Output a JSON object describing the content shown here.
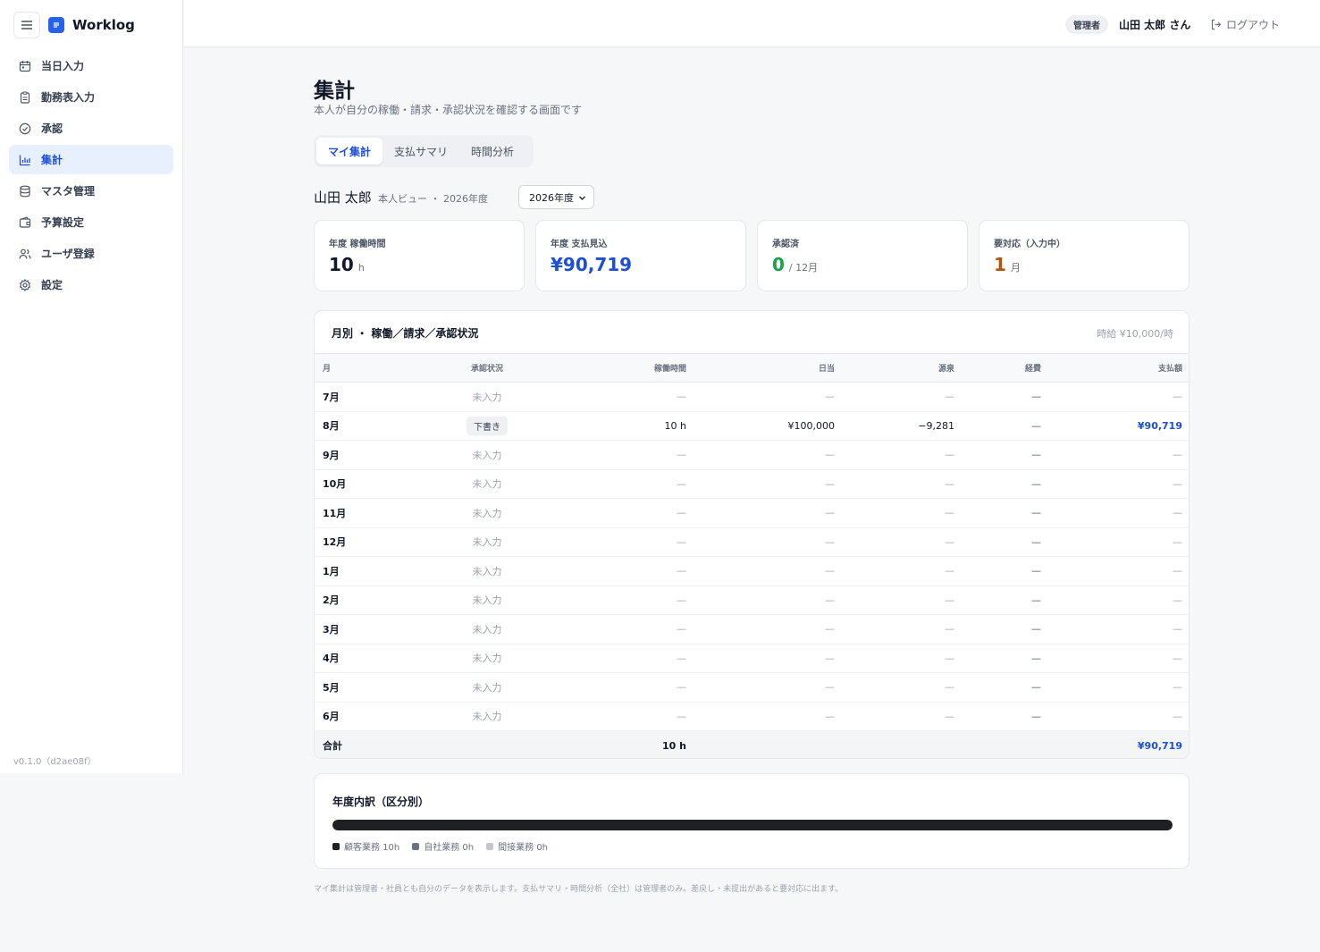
{
  "app": {
    "name": "Worklog",
    "version": "v0.1.0（d2ae08f）",
    "accent": "#2563eb"
  },
  "sidebar": {
    "items": [
      {
        "label": "当日入力",
        "icon": "calendar-icon"
      },
      {
        "label": "勤務表入力",
        "icon": "clipboard-icon"
      },
      {
        "label": "承認",
        "icon": "check-circle-icon"
      },
      {
        "label": "集計",
        "icon": "bar-chart-icon",
        "active": true
      },
      {
        "label": "マスタ管理",
        "icon": "database-icon"
      },
      {
        "label": "予算設定",
        "icon": "wallet-icon"
      },
      {
        "label": "ユーザ登録",
        "icon": "users-icon"
      },
      {
        "label": "設定",
        "icon": "gear-icon"
      }
    ]
  },
  "header": {
    "role": "管理者",
    "user": "山田 太郎 さん",
    "logout": "ログアウト"
  },
  "page": {
    "title": "集計",
    "subtitle": "本人が自分の稼働・請求・承認状況を確認する画面です",
    "tabs": [
      {
        "label": "マイ集計",
        "active": true
      },
      {
        "label": "支払サマリ"
      },
      {
        "label": "時間分析"
      }
    ],
    "person": "山田 太郎",
    "view": "本人ビュー ・ 2026年度",
    "year_select": "2026年度"
  },
  "cards": [
    {
      "label": "年度 稼働時間",
      "value": "10",
      "unit": "h",
      "color": "#111827"
    },
    {
      "label": "年度 支払見込",
      "value": "¥90,719",
      "unit": "",
      "color": "#1d4ed8"
    },
    {
      "label": "承認済",
      "value": "0",
      "unit": "/ 12月",
      "color": "#16a34a"
    },
    {
      "label": "要対応（入力中）",
      "value": "1",
      "unit": "月",
      "color": "#b45309"
    }
  ],
  "monthly": {
    "title": "月別 ・ 稼働／請求／承認状況",
    "rate": "時給 ¥10,000/時",
    "headers": [
      "月",
      "承認状況",
      "稼働時間",
      "日当",
      "源泉",
      "経費",
      "支払額"
    ],
    "rows": [
      {
        "month": "7月",
        "status": "未入力",
        "hours": "—",
        "daily": "—",
        "tax": "—",
        "expense": "—",
        "pay": "—"
      },
      {
        "month": "8月",
        "status": "下書き",
        "draft": true,
        "hours": "10 h",
        "daily": "¥100,000",
        "tax": "−9,281",
        "expense": "—",
        "pay": "¥90,719"
      },
      {
        "month": "9月",
        "status": "未入力",
        "hours": "—",
        "daily": "—",
        "tax": "—",
        "expense": "—",
        "pay": "—"
      },
      {
        "month": "10月",
        "status": "未入力",
        "hours": "—",
        "daily": "—",
        "tax": "—",
        "expense": "—",
        "pay": "—"
      },
      {
        "month": "11月",
        "status": "未入力",
        "hours": "—",
        "daily": "—",
        "tax": "—",
        "expense": "—",
        "pay": "—"
      },
      {
        "month": "12月",
        "status": "未入力",
        "hours": "—",
        "daily": "—",
        "tax": "—",
        "expense": "—",
        "pay": "—"
      },
      {
        "month": "1月",
        "status": "未入力",
        "hours": "—",
        "daily": "—",
        "tax": "—",
        "expense": "—",
        "pay": "—"
      },
      {
        "month": "2月",
        "status": "未入力",
        "hours": "—",
        "daily": "—",
        "tax": "—",
        "expense": "—",
        "pay": "—"
      },
      {
        "month": "3月",
        "status": "未入力",
        "hours": "—",
        "daily": "—",
        "tax": "—",
        "expense": "—",
        "pay": "—"
      },
      {
        "month": "4月",
        "status": "未入力",
        "hours": "—",
        "daily": "—",
        "tax": "—",
        "expense": "—",
        "pay": "—"
      },
      {
        "month": "5月",
        "status": "未入力",
        "hours": "—",
        "daily": "—",
        "tax": "—",
        "expense": "—",
        "pay": "—"
      },
      {
        "month": "6月",
        "status": "未入力",
        "hours": "—",
        "daily": "—",
        "tax": "—",
        "expense": "—",
        "pay": "—"
      }
    ],
    "total": {
      "label": "合計",
      "hours": "10 h",
      "pay": "¥90,719"
    }
  },
  "breakdown": {
    "title": "年度内訳（区分別）",
    "share": 1.0,
    "legend": [
      {
        "label": "顧客業務 10h",
        "color": "#1f2023"
      },
      {
        "label": "自社業務 0h",
        "color": "#6b7280"
      },
      {
        "label": "間接業務 0h",
        "color": "#c4c8ce"
      }
    ]
  },
  "footnote": "マイ集計は管理者・社員とも自分のデータを表示します。支払サマリ・時間分析（全社）は管理者のみ。差戻し・未提出があると要対応に出ます。"
}
